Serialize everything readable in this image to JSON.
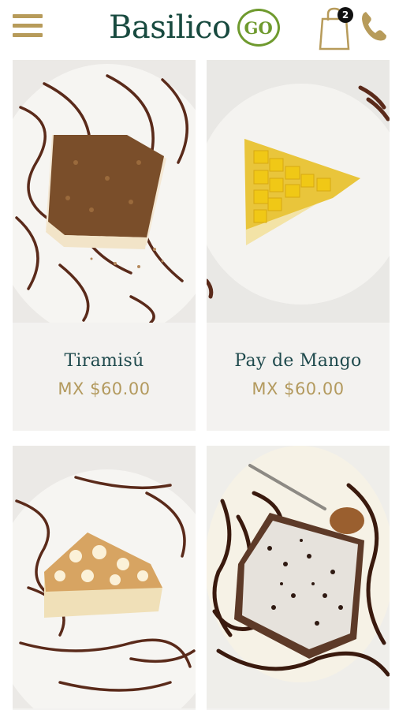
{
  "header": {
    "brand_name": "Basilico",
    "brand_suffix": "GO",
    "cart_count": "2",
    "accent_color": "#b79b5a",
    "brand_color": "#184a3f",
    "go_color": "#6f9a2e"
  },
  "icons": {
    "menu": "hamburger-menu-icon",
    "cart": "shopping-bag-icon",
    "phone": "phone-icon"
  },
  "products": [
    {
      "name": "Tiramisú",
      "price": "MX $60.00"
    },
    {
      "name": "Pay de Mango",
      "price": "MX $60.00"
    },
    {
      "name": "",
      "price": ""
    },
    {
      "name": "",
      "price": ""
    }
  ]
}
